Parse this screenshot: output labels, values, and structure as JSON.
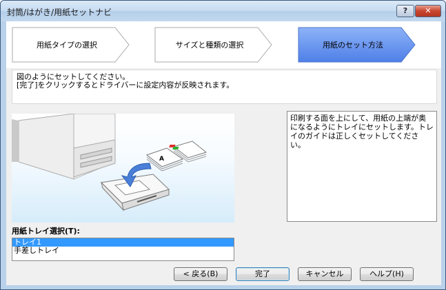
{
  "window": {
    "title": "封筒/はがき/用紙セットナビ"
  },
  "title_buttons": {
    "help": "?",
    "close": "✕"
  },
  "steps": [
    {
      "label": "用紙タイプの選択",
      "active": false
    },
    {
      "label": "サイズと種類の選択",
      "active": false
    },
    {
      "label": "用紙のセット方法",
      "active": true
    }
  ],
  "instructions": {
    "line1": "図のようにセットしてください。",
    "line2": "[完了]をクリックするとドライバーに設定内容が反映されます。"
  },
  "description": "印刷する面を上にして、用紙の上端が奥になるようにトレイにセットします。トレイのガイドは正しくセットしてください。",
  "illustration": {
    "paper_mark": "A"
  },
  "tray": {
    "label": "用紙トレイ選択(T):",
    "options": [
      "トレイ1",
      "手差しトレイ"
    ],
    "selected_index": 0
  },
  "buttons": {
    "back": "< 戻る(B)",
    "finish": "完了",
    "cancel": "キャンセル",
    "help": "ヘルプ(H)"
  },
  "colors": {
    "active_step": "#5b8df0",
    "inactive_step": "#ffffff",
    "selection": "#3399ff"
  }
}
